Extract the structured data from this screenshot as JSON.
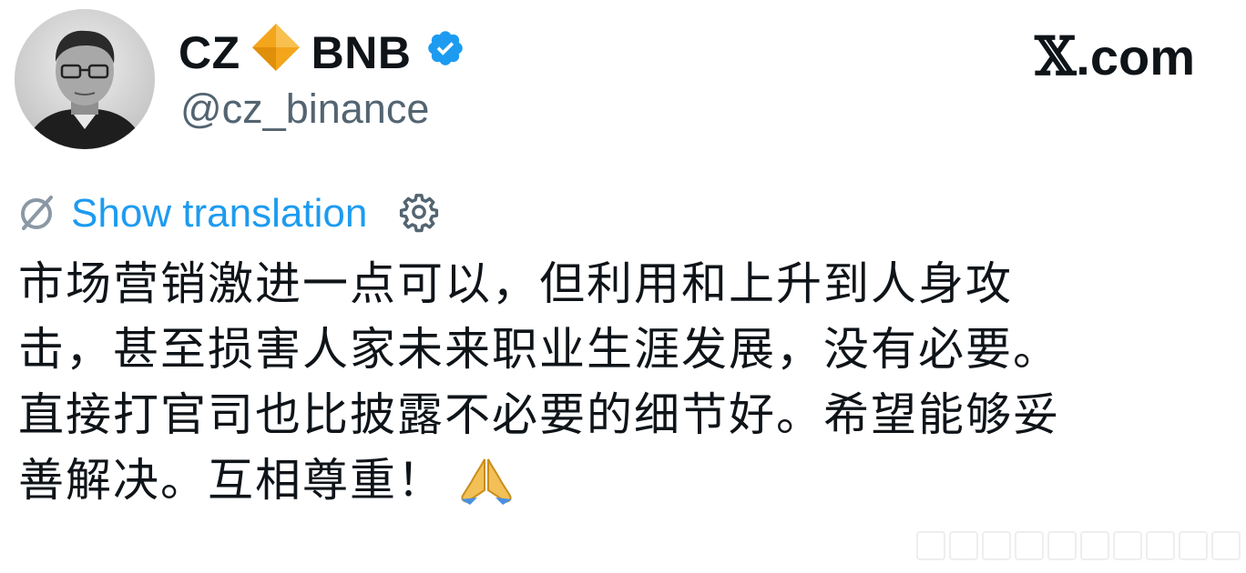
{
  "author": {
    "name": "CZ",
    "name_suffix": "BNB",
    "handle": "@cz_binance",
    "verified": true,
    "diamond_color": "#F3A51C",
    "verified_color": "#1D9BF0"
  },
  "brand": {
    "label": ".com",
    "icon": "x-logo-icon"
  },
  "translation": {
    "label": "Show translation",
    "icon": "translate-icon",
    "settings_icon": "gear-icon",
    "color": "#1D9BF0"
  },
  "tweet": {
    "lines": [
      "市场营销激进一点可以，但利用和上升到人身攻",
      "击，甚至损害人家未来职业生涯发展，没有必要。",
      "直接打官司也比披露不必要的细节好。希望能够妥",
      "善解决。互相尊重！"
    ],
    "emoji": "folded-hands-icon"
  }
}
